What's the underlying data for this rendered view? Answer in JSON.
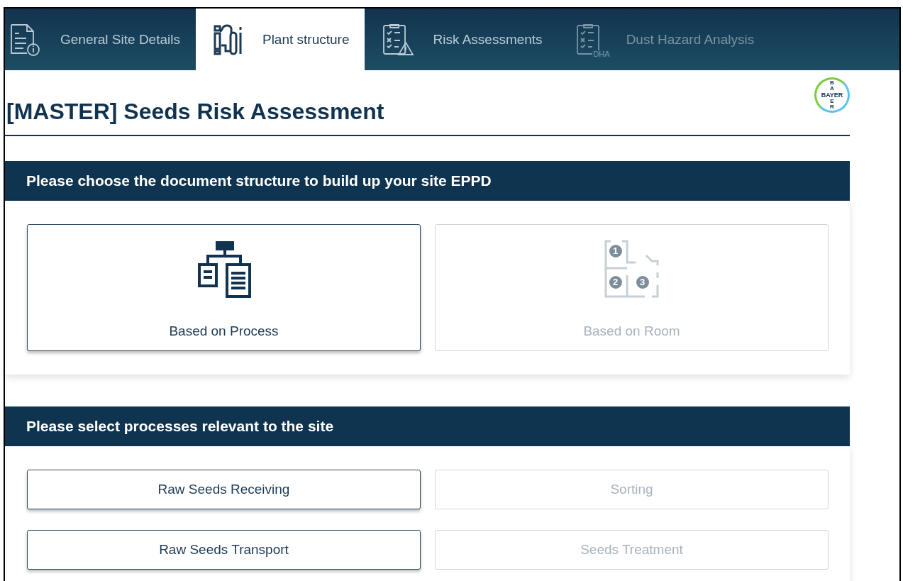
{
  "tabs": [
    {
      "label": "General Site Details",
      "kind": "details",
      "selected": false,
      "disabled": false
    },
    {
      "label": "Plant structure",
      "kind": "plant",
      "selected": true,
      "disabled": false
    },
    {
      "label": "Risk Assessments",
      "kind": "risk",
      "selected": false,
      "disabled": false
    },
    {
      "label": "Dust Hazard Analysis",
      "kind": "dha",
      "selected": false,
      "disabled": true,
      "icon_text": "DHA"
    }
  ],
  "title": "[MASTER] Seeds Risk Assessment",
  "logo": {
    "top": "BA",
    "middle": "BAYER",
    "bottom": "ER"
  },
  "structure": {
    "heading": "Please choose the document structure to build up your site EPPD",
    "options": [
      {
        "label": "Based on Process",
        "kind": "process",
        "selected": true
      },
      {
        "label": "Based on Room",
        "kind": "room",
        "selected": false,
        "room_numbers": [
          "1",
          "2",
          "3"
        ]
      }
    ]
  },
  "processes": {
    "heading": "Please select processes relevant to the site",
    "items": [
      {
        "label": "Raw Seeds Receiving",
        "selected": true
      },
      {
        "label": "Sorting",
        "selected": false
      },
      {
        "label": "Raw Seeds Transport",
        "selected": true
      },
      {
        "label": "Seeds Treatment",
        "selected": false
      }
    ]
  }
}
